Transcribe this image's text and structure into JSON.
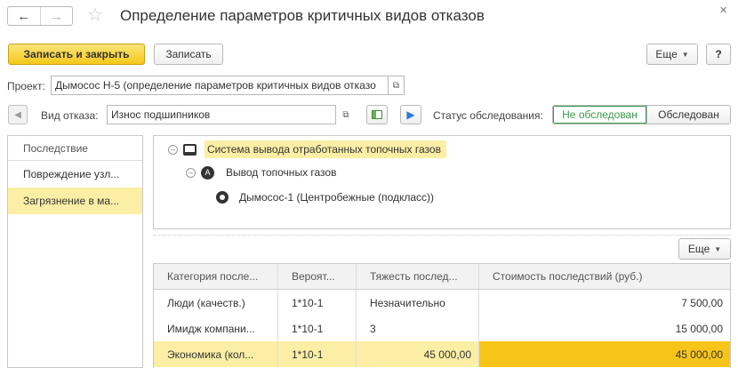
{
  "window": {
    "title": "Определение параметров критичных видов отказов",
    "back_glyph": "←",
    "forward_glyph": "→",
    "star_glyph": "☆",
    "close_glyph": "×"
  },
  "toolbar": {
    "save_close_label": "Записать и закрыть",
    "save_label": "Записать",
    "more_label": "Еще",
    "help_label": "?"
  },
  "project": {
    "label": "Проект:",
    "value": "Дымосос Н-5 (определение параметров критичных видов отказо"
  },
  "failure": {
    "label": "Вид отказа:",
    "value": "Износ подшипников",
    "status_label": "Статус обследования:",
    "status_options": [
      "Не обследован",
      "Обследован"
    ],
    "status_selected": "Не обследован"
  },
  "consequences": {
    "header": "Последствие",
    "items": [
      {
        "label": "Повреждение узл..."
      },
      {
        "label": "Загрязнение в ма..."
      }
    ],
    "selected_index": 1
  },
  "tree": {
    "system": "Система вывода отработанных топочных газов",
    "node": "Вывод топочных газов",
    "node_glyph": "A",
    "leaf": "Дымосос-1 (Центробежные (подкласс))"
  },
  "grid": {
    "more_label": "Еще",
    "columns": [
      "Категория после...",
      "Вероят...",
      "Тяжесть послед...",
      "Стоимость последствий (руб.)"
    ],
    "rows": [
      {
        "category": "Люди (качеств.)",
        "probability": "1*10-1",
        "severity": "Незначительно",
        "cost": "7 500,00"
      },
      {
        "category": "Имидж компани...",
        "probability": "1*10-1",
        "severity": "3",
        "cost": "15 000,00"
      },
      {
        "category": "Экономика (кол...",
        "probability": "1*10-1",
        "severity": "45 000,00",
        "cost": "45 000,00"
      }
    ]
  },
  "colors": {
    "primary_button": "#f5c81a",
    "selection": "#fcefa5",
    "active_cell": "#f7c51a",
    "status_green": "#3a9a4a",
    "nav_blue": "#2a7ad8"
  }
}
